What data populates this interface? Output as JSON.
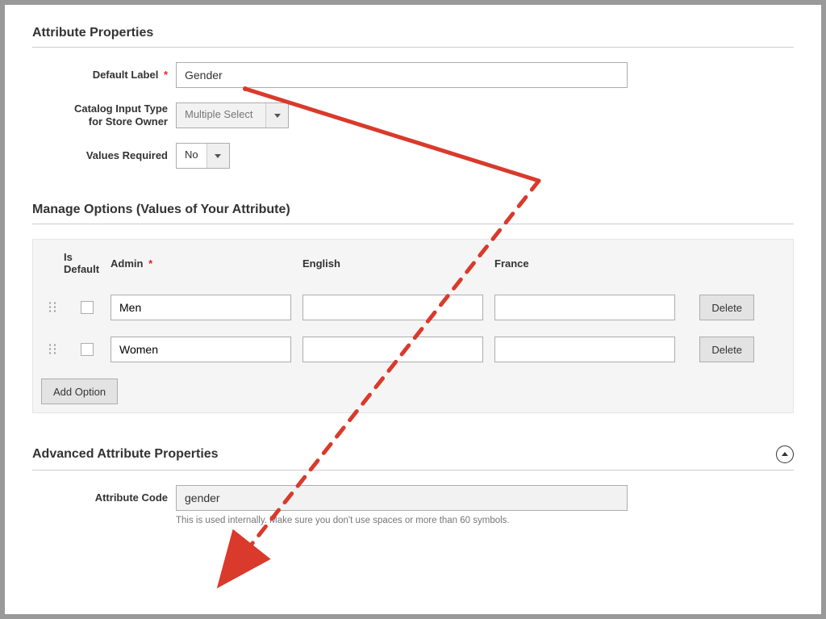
{
  "sections": {
    "attr_props_title": "Attribute Properties",
    "manage_opts_title": "Manage Options (Values of Your Attribute)",
    "adv_props_title": "Advanced Attribute Properties"
  },
  "fields": {
    "default_label": {
      "label": "Default Label",
      "value": "Gender",
      "required": true
    },
    "catalog_input_type": {
      "label_line1": "Catalog Input Type",
      "label_line2": "for Store Owner",
      "value": "Multiple Select"
    },
    "values_required": {
      "label": "Values Required",
      "value": "No"
    },
    "attribute_code": {
      "label": "Attribute Code",
      "value": "gender",
      "help": "This is used internally. Make sure you don't use spaces or more than 60 symbols."
    }
  },
  "options_table": {
    "headers": {
      "is_default": "Is Default",
      "admin": "Admin",
      "english": "English",
      "france": "France"
    },
    "admin_required": true,
    "rows": [
      {
        "admin": "Men",
        "english": "",
        "france": ""
      },
      {
        "admin": "Women",
        "english": "",
        "france": ""
      }
    ],
    "delete_label": "Delete",
    "add_option_label": "Add Option"
  },
  "required_marker": "*"
}
